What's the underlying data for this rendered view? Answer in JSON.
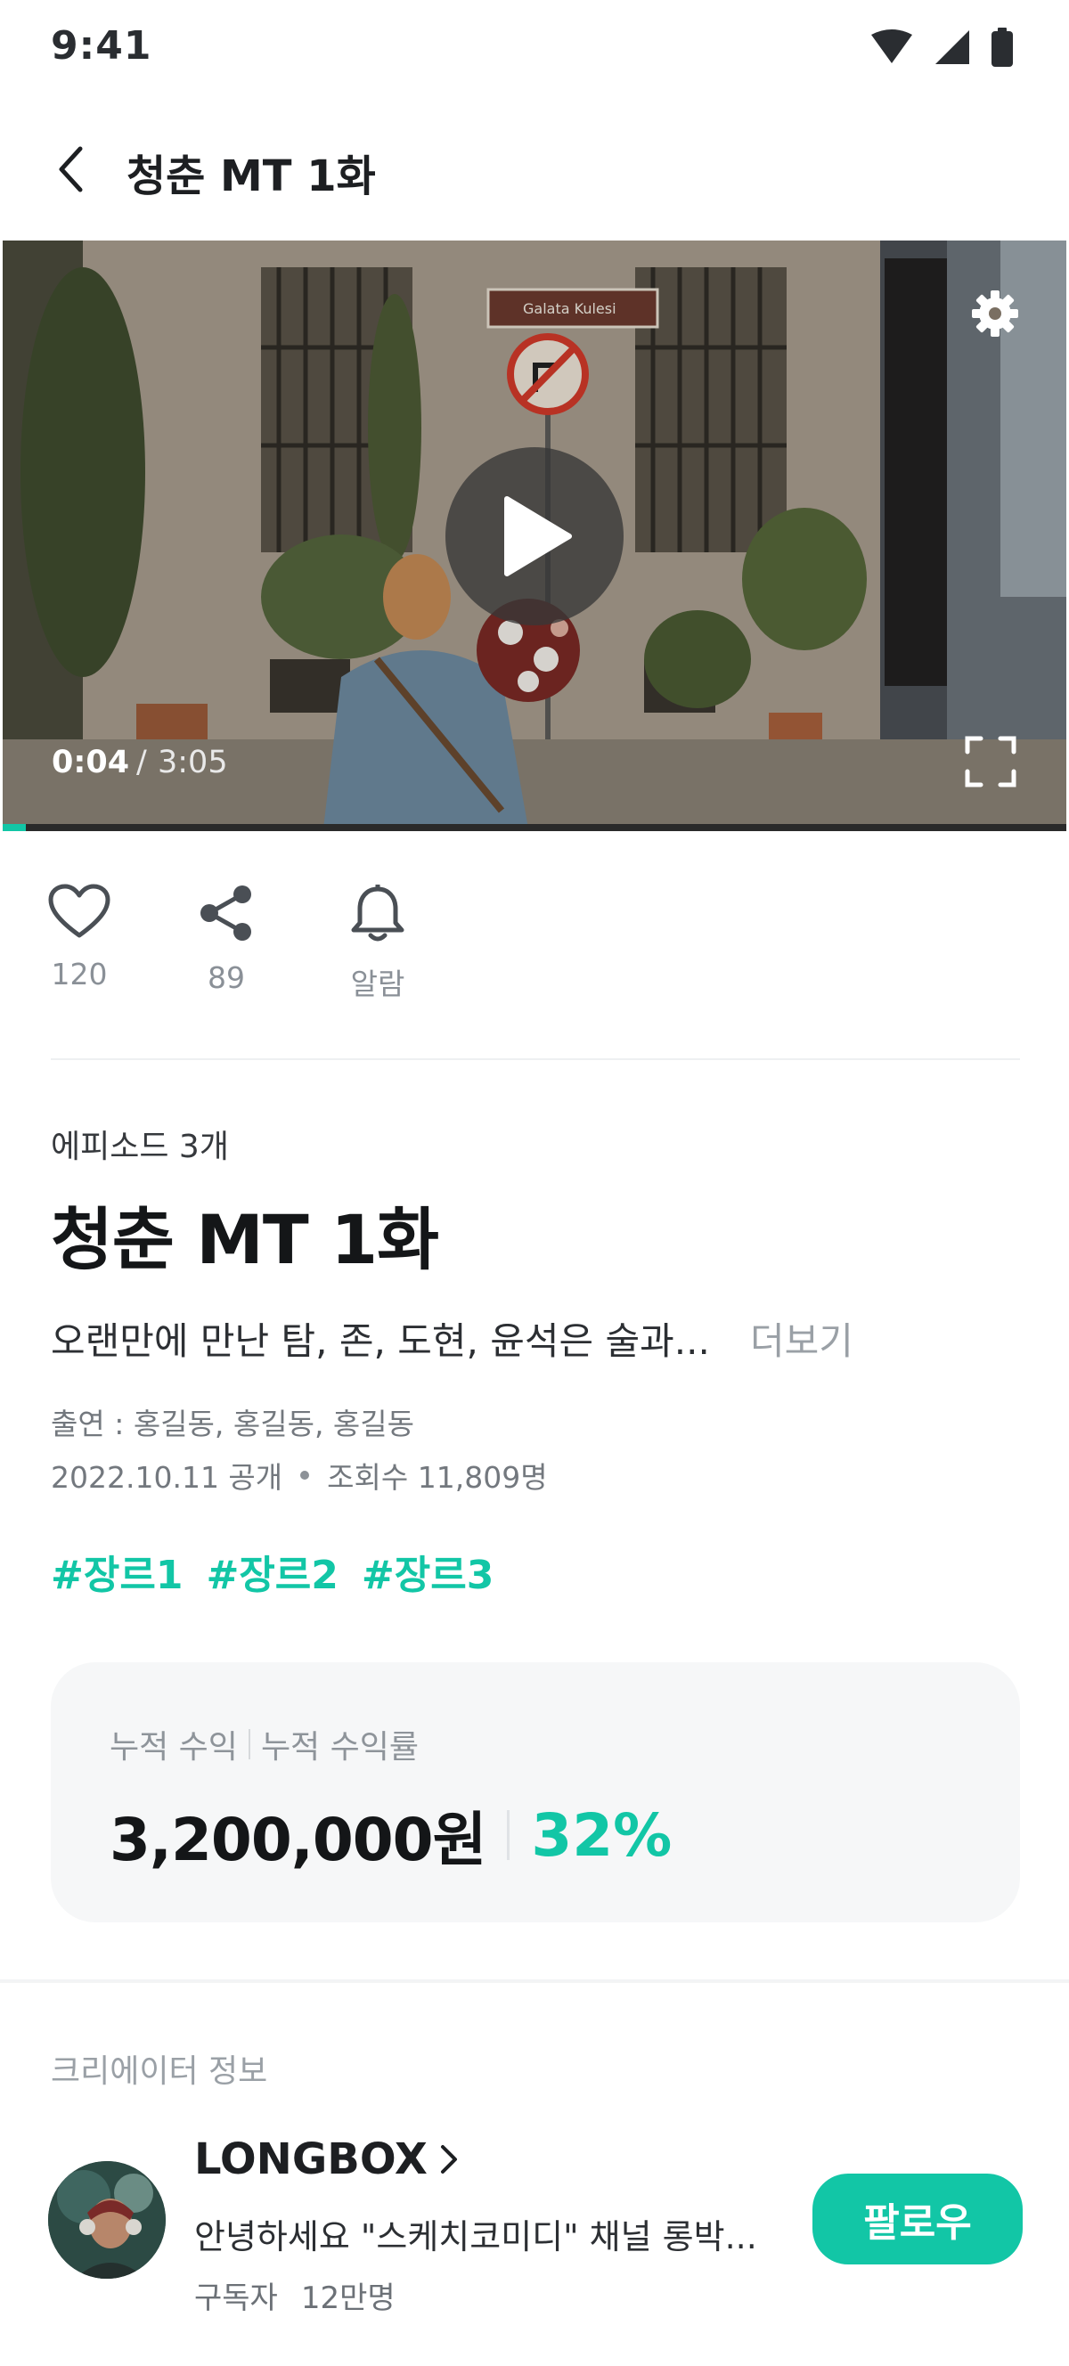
{
  "status_bar": {
    "time": "9:41"
  },
  "header": {
    "title": "청춘 MT 1화"
  },
  "video": {
    "current_time": "0:04",
    "separator": "/",
    "duration": "3:05",
    "progress": 0.022,
    "sign_text": "Galata Kulesi"
  },
  "actions": [
    {
      "icon": "heart-icon",
      "label": "120"
    },
    {
      "icon": "share-icon",
      "label": "89"
    },
    {
      "icon": "bell-icon",
      "label": "알람"
    }
  ],
  "episode": {
    "count_label": "에피소드 3개",
    "title": "청춘 MT 1화",
    "description": "오랜만에 만난 탐, 존, 도현, 윤석은 술과...",
    "more_label": "더보기",
    "cast": "출연 : 홍길동, 홍길동, 홍길동",
    "release": "2022.10.11 공개",
    "views": "조회수 11,809명",
    "tags": [
      "#장르1",
      "#장르2",
      "#장르3"
    ]
  },
  "earnings": {
    "label_revenue": "누적 수익",
    "label_rate": "누적 수익률",
    "amount": "3,200,000원",
    "rate": "32%"
  },
  "creator": {
    "section_title": "크리에이터 정보",
    "name": "LONGBOX",
    "intro": "안녕하세요 \"스케치코미디\" 채널 롱박...",
    "subscribers_label": "구독자",
    "subscribers_value": "12만명",
    "follow_label": "팔로우"
  },
  "colors": {
    "accent": "#12c6a6",
    "text": "#1d1f22",
    "muted": "#8a9097",
    "card_bg": "#f6f7f8"
  }
}
